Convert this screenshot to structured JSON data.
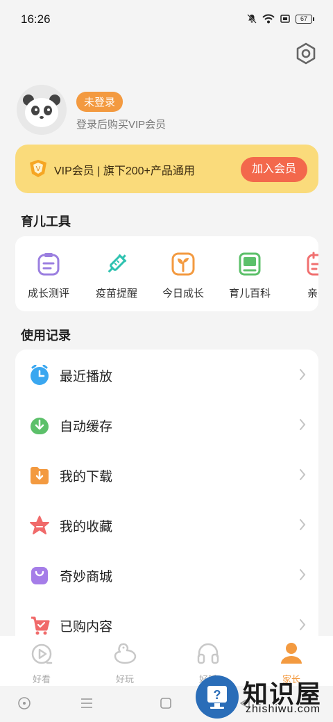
{
  "status_bar": {
    "time": "16:26",
    "battery": "67"
  },
  "profile": {
    "login_badge": "未登录",
    "hint": "登录后购买VIP会员"
  },
  "vip_banner": {
    "text": "VIP会员 | 旗下200+产品通用",
    "join_button": "加入会员"
  },
  "tools_section": {
    "title": "育儿工具",
    "items": [
      {
        "label": "成长测评",
        "icon": "clipboard-icon",
        "color": "#9b7fe0"
      },
      {
        "label": "疫苗提醒",
        "icon": "syringe-icon",
        "color": "#2fc2b0"
      },
      {
        "label": "今日成长",
        "icon": "sprout-icon",
        "color": "#f39a40"
      },
      {
        "label": "育儿百科",
        "icon": "book-icon",
        "color": "#5cc06a"
      },
      {
        "label": "亲子",
        "icon": "calendar-icon",
        "color": "#f07070"
      }
    ]
  },
  "records_section": {
    "title": "使用记录",
    "items": [
      {
        "label": "最近播放",
        "icon": "clock-icon",
        "color": "#3aa7f0"
      },
      {
        "label": "自动缓存",
        "icon": "download-circle-icon",
        "color": "#5cc06a"
      },
      {
        "label": "我的下载",
        "icon": "download-folder-icon",
        "color": "#f39a40"
      },
      {
        "label": "我的收藏",
        "icon": "star-icon",
        "color": "#f06a6a"
      },
      {
        "label": "奇妙商城",
        "icon": "shopping-bag-icon",
        "color": "#a57de8"
      },
      {
        "label": "已购内容",
        "icon": "cart-icon",
        "color": "#f06a6a"
      }
    ]
  },
  "tab_bar": {
    "tabs": [
      {
        "label": "好看",
        "active": false
      },
      {
        "label": "好玩",
        "active": false
      },
      {
        "label": "好听",
        "active": false
      },
      {
        "label": "家长",
        "active": true
      }
    ],
    "active_color": "#f39a40"
  },
  "watermark": {
    "title": "知识屋",
    "subtitle": "zhishiwu.com"
  }
}
